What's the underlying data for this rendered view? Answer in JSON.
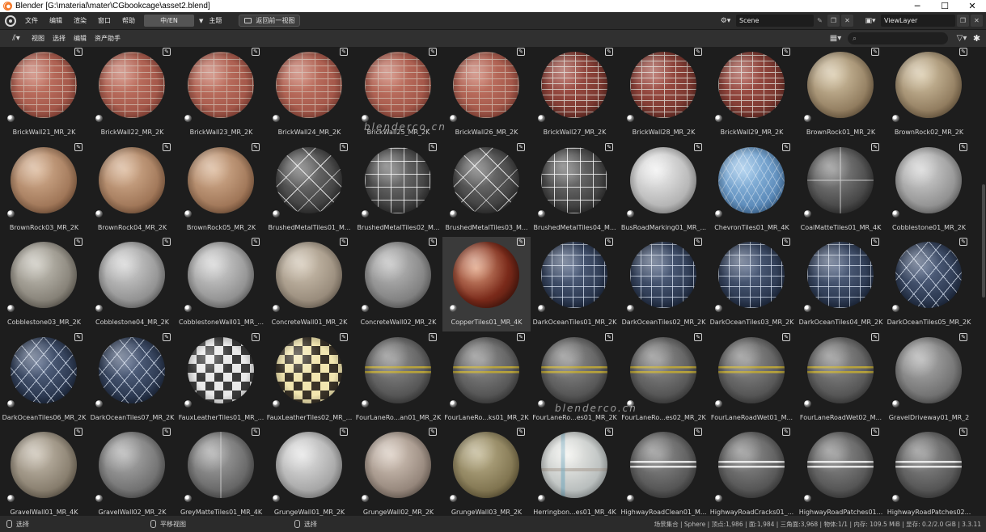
{
  "window": {
    "title": "Blender [G:\\material\\mater\\CGbookcage\\asset2.blend]",
    "minimize": "─",
    "maximize": "☐",
    "close": "✕"
  },
  "topbar": {
    "menus": [
      "文件",
      "编辑",
      "渲染",
      "窗口",
      "帮助"
    ],
    "language_button": "中/EN",
    "theme_menu": "主题",
    "back_button": "返回前一视图",
    "scene_name": "Scene",
    "view_layer_name": "ViewLayer"
  },
  "editor_header": {
    "menus": [
      "视图",
      "选择",
      "编辑",
      "资产助手"
    ],
    "search_icon": "⌕",
    "search_placeholder": ""
  },
  "assets": [
    "BrickWall21_MR_2K",
    "BrickWall22_MR_2K",
    "BrickWall23_MR_2K",
    "BrickWall24_MR_2K",
    "BrickWall25_MR_2K",
    "BrickWall26_MR_2K",
    "BrickWall27_MR_2K",
    "BrickWall28_MR_2K",
    "BrickWall29_MR_2K",
    "BrownRock01_MR_2K",
    "BrownRock02_MR_2K",
    "BrownRock03_MR_2K",
    "BrownRock04_MR_2K",
    "BrownRock05_MR_2K",
    "BrushedMetalTiles01_M...",
    "BrushedMetalTiles02_M...",
    "BrushedMetalTiles03_M...",
    "BrushedMetalTiles04_M...",
    "BusRoadMarking01_MR_...",
    "ChevronTiles01_MR_4K",
    "CoalMatteTiles01_MR_4K",
    "Cobblestone01_MR_2K",
    "Cobblestone03_MR_2K",
    "Cobblestone04_MR_2K",
    "CobblestoneWall01_MR_...",
    "ConcreteWall01_MR_2K",
    "ConcreteWall02_MR_2K",
    "CopperTiles01_MR_4K",
    "DarkOceanTiles01_MR_2K",
    "DarkOceanTiles02_MR_2K",
    "DarkOceanTiles03_MR_2K",
    "DarkOceanTiles04_MR_2K",
    "DarkOceanTiles05_MR_2K",
    "DarkOceanTiles06_MR_2K",
    "DarkOceanTiles07_MR_2K",
    "FauxLeatherTiles01_MR_...",
    "FauxLeatherTiles02_MR_...",
    "FourLaneRo...an01_MR_2K",
    "FourLaneRo...ks01_MR_2K",
    "FourLaneRo...es01_MR_2K",
    "FourLaneRo...es02_MR_2K",
    "FourLaneRoadWet01_M...",
    "FourLaneRoadWet02_M...",
    "GravelDriveway01_MR_2",
    "GravelWall01_MR_4K",
    "GravelWall02_MR_2K",
    "GreyMatteTiles01_MR_4K",
    "GrungeWall01_MR_2K",
    "GrungeWall02_MR_2K",
    "GrungeWall03_MR_2K",
    "Herringbon...es01_MR_4K",
    "HighwayRoadClean01_M...",
    "HighwayRoadCracks01_...",
    "HighwayRoadPatches01...",
    "HighwayRoadPatches02..."
  ],
  "materials": [
    "m-brick",
    "m-brick",
    "m-brick",
    "m-brick",
    "m-brick",
    "m-brick",
    "m-brick2",
    "m-brick2",
    "m-brick2",
    "m-rock",
    "m-rock",
    "m-rockb",
    "m-rockb",
    "m-rockb",
    "m-metalgrid",
    "m-metalsq",
    "m-metalgrid",
    "m-metalsq",
    "m-white",
    "m-chevron",
    "m-coal",
    "m-cobble",
    "m-cobble3",
    "m-cobble",
    "m-cobble",
    "m-concrete",
    "m-concrete2",
    "m-copper",
    "m-ocean",
    "m-ocean",
    "m-ocean",
    "m-ocean",
    "m-oceandiag",
    "m-oceandiag",
    "m-oceandiag",
    "m-faux",
    "m-faux2",
    "m-road",
    "m-road",
    "m-road",
    "m-road",
    "m-road",
    "m-road",
    "m-gravel2",
    "m-gravel",
    "m-gravel2",
    "m-grey",
    "m-grunge",
    "m-grunge2",
    "m-grunge3",
    "m-herring",
    "m-road-white",
    "m-road-white",
    "m-road-white",
    "m-road-white"
  ],
  "active_asset": "CopperTiles01_MR_4K",
  "statusbar": {
    "left_action": "选择",
    "middle_action": "平移视图",
    "right_action": "选择",
    "stats": "场景集合 | Sphere | 顶点:1,986 | 面:1,984 | 三角面:3,968 | 物体:1/1 | 内存: 109.5 MiB | 显存: 0.2/2.0 GiB | 3.3.11"
  },
  "watermarks": [
    "blenderco.cn",
    "blenderco.cn"
  ]
}
